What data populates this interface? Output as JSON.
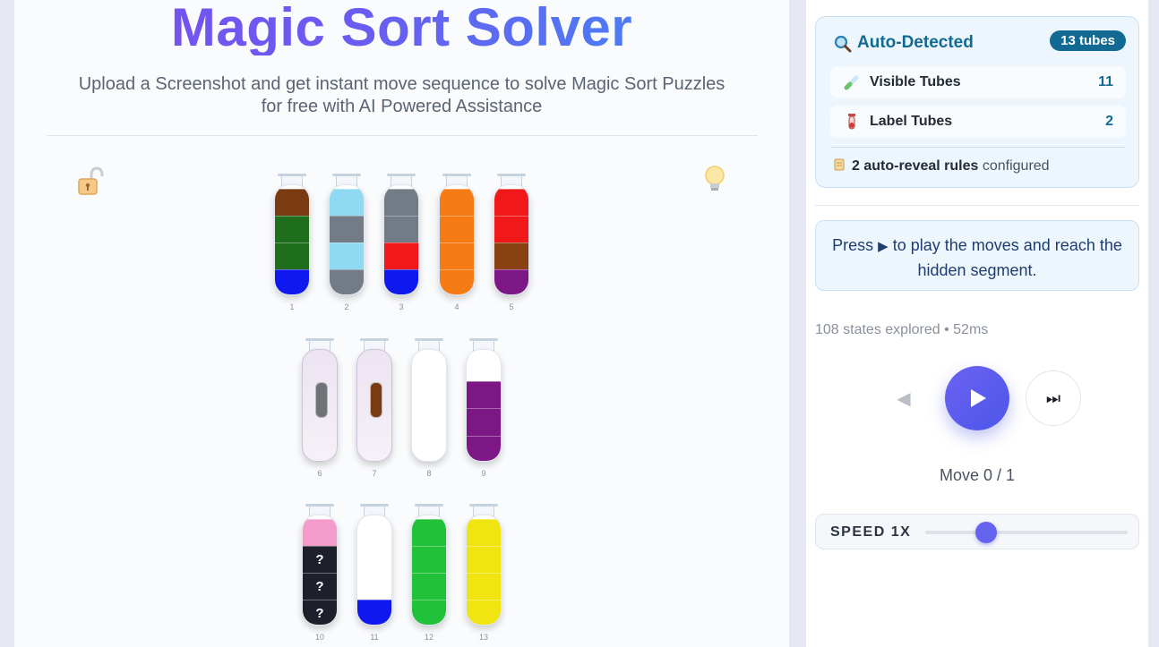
{
  "header": {
    "title": "Magic Sort Solver",
    "subtitle": "Upload a Screenshot and get instant move sequence to solve Magic Sort Puzzles for free with AI Powered Assistance"
  },
  "icons": {
    "lock": "unlocked-padlock-icon",
    "hint": "lightbulb-icon"
  },
  "tubes": [
    {
      "label": "1",
      "segments": [
        "#7a3b13",
        "#1e6e1c",
        "#1e6e1c",
        "#1018f0"
      ]
    },
    {
      "label": "2",
      "segments": [
        "#8fd9f3",
        "#737b86",
        "#8fd9f3",
        "#737b86"
      ]
    },
    {
      "label": "3",
      "segments": [
        "#737b86",
        "#737b86",
        "#f01818",
        "#1018f0"
      ]
    },
    {
      "label": "4",
      "segments": [
        "#f77b14",
        "#f77b14",
        "#f77b14",
        "#f77b14"
      ]
    },
    {
      "label": "5",
      "segments": [
        "#f01818",
        "#f01818",
        "#8a4112",
        "#7d1785"
      ]
    },
    {
      "label": "6",
      "hidden": true,
      "inner_color": "#6f7378"
    },
    {
      "label": "7",
      "hidden": true,
      "inner_color": "#7a3b13"
    },
    {
      "label": "8",
      "segments": []
    },
    {
      "label": "9",
      "segments": [
        "#7d1785",
        "#7d1785",
        "#7d1785"
      ]
    },
    {
      "label": "10",
      "segments": [
        "#f39ccb",
        "?",
        "?",
        "?"
      ]
    },
    {
      "label": "11",
      "segments": [
        "#1018f0"
      ]
    },
    {
      "label": "12",
      "segments": [
        "#22c13a",
        "#22c13a",
        "#22c13a",
        "#22c13a"
      ]
    },
    {
      "label": "13",
      "segments": [
        "#f0e511",
        "#f0e511",
        "#f0e511",
        "#f0e511"
      ]
    }
  ],
  "detection": {
    "title": "Auto-Detected",
    "badge": "13 tubes",
    "visible_label": "Visible Tubes",
    "visible_value": "11",
    "label_label": "Label Tubes",
    "label_value": "2",
    "rules_count": "2 auto-reveal rules",
    "rules_suffix": "configured"
  },
  "hint": {
    "text_prefix": "Press",
    "text_suffix": "to play the moves and reach the hidden segment."
  },
  "solver": {
    "stats": "108 states explored • 52ms",
    "move": "Move 0 / 1"
  },
  "speed": {
    "label": "SPEED 1X",
    "level_fraction": 0.3
  },
  "colors": {
    "accent": "#6563ee",
    "detect_text": "#126a93"
  }
}
